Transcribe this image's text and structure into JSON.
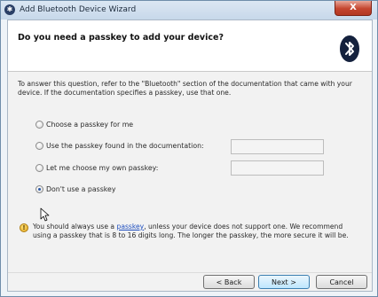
{
  "window": {
    "title": "Add Bluetooth Device Wizard",
    "close_glyph": "X"
  },
  "header": {
    "question": "Do you need a passkey to add your device?",
    "logo": "bluetooth-icon"
  },
  "intro": "To answer this question, refer to the \"Bluetooth\" section of the documentation that came with your device. If the documentation specifies a passkey, use that one.",
  "options": [
    {
      "label": "Choose a passkey for me",
      "checked": false
    },
    {
      "label": "Use the passkey found in the documentation:",
      "checked": false
    },
    {
      "label": "Let me choose my own passkey:",
      "checked": false
    },
    {
      "label": "Don't use a passkey",
      "checked": true
    }
  ],
  "fields": {
    "documentation_passkey": "",
    "own_passkey": ""
  },
  "warning": {
    "icon": "warning-shield-icon",
    "before_link": "You should always use a ",
    "link": "passkey",
    "after_link": ", unless your device does not support one. We recommend using a passkey that is 8 to 16 digits long. The longer the passkey, the more secure it will be."
  },
  "buttons": {
    "back": "< Back",
    "next": "Next >",
    "cancel": "Cancel"
  }
}
